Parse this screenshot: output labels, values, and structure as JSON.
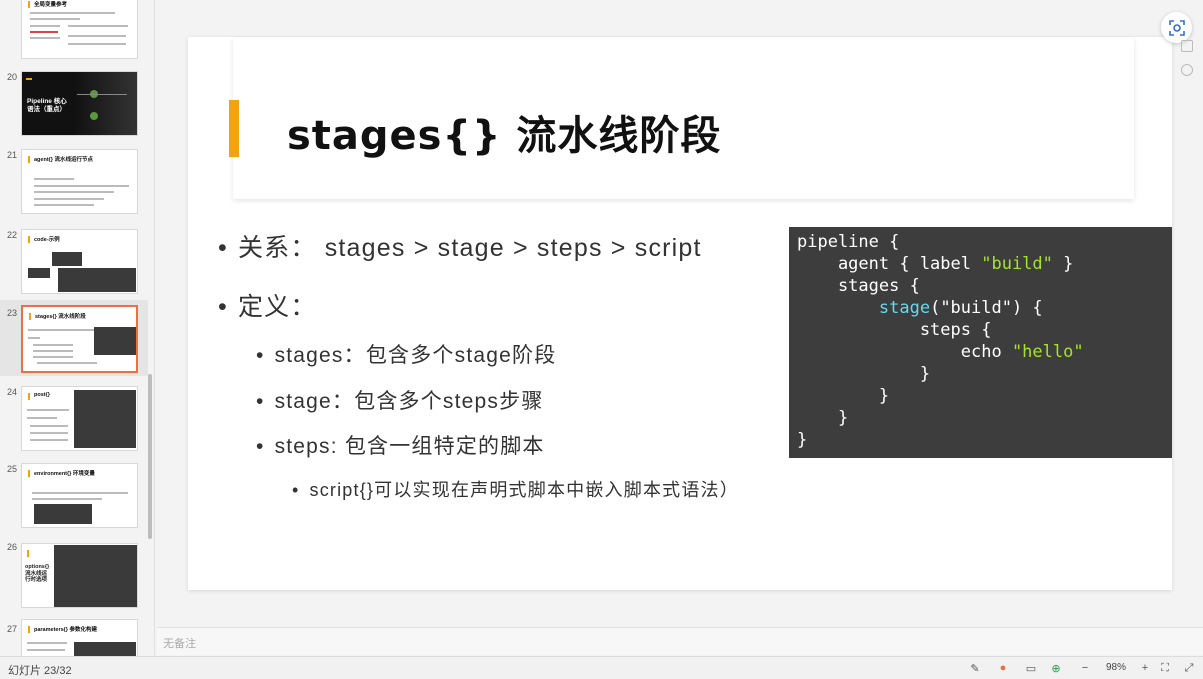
{
  "thumbnails": [
    {
      "num": "",
      "title": "全局变量参考"
    },
    {
      "num": "20",
      "title": "Pipeline 核心语法（重点）"
    },
    {
      "num": "21",
      "title": "agent{} 流水线运行节点"
    },
    {
      "num": "22",
      "title": "code-示例"
    },
    {
      "num": "23",
      "title": "stages{} 流水线阶段"
    },
    {
      "num": "24",
      "title": "post{}"
    },
    {
      "num": "25",
      "title": "environment{} 环境变量"
    },
    {
      "num": "26",
      "title": "options{} 流水线运行时选项"
    },
    {
      "num": "27",
      "title": "parameters{} 参数化构建"
    }
  ],
  "slide": {
    "title": "stages{} 流水线阶段",
    "bullets": {
      "relation": "关系： stages > stage > steps > script",
      "definition": "定义：",
      "stages": "stages：包含多个stage阶段",
      "stage": "stage：包含多个steps步骤",
      "steps": "steps: 包含一组特定的脚本",
      "script": "script{}可以实现在声明式脚本中嵌入脚本式语法）"
    },
    "code": {
      "l1": "pipeline {",
      "l2a": "    agent { label ",
      "l2s": "\"build\"",
      "l2b": " }",
      "l3": "    stages {",
      "l4a": "        ",
      "l4f": "stage",
      "l4b": "(\"build\") {",
      "l5": "            steps {",
      "l6a": "                echo ",
      "l6s": "\"hello\"",
      "l7": "            }",
      "l8": "        }",
      "l9": "    }",
      "l10": "}"
    }
  },
  "notes_placeholder": "无备注",
  "status": {
    "slide_count": "幻灯片 23/32",
    "zoom": "98%"
  },
  "icons": {
    "lens": "screen-lens-icon",
    "minus": "zoom-out-icon",
    "plus": "zoom-in-icon"
  }
}
